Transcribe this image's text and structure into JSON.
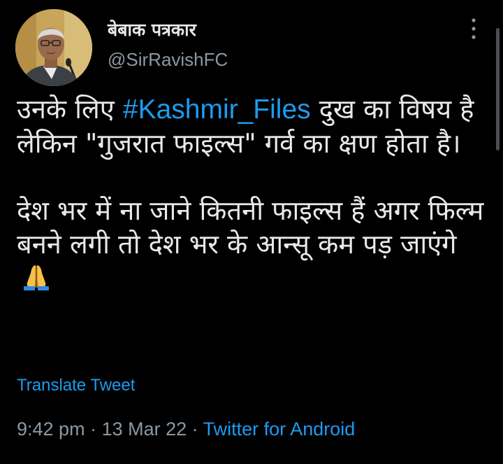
{
  "tweet": {
    "author": {
      "display_name": "बेबाक पत्रकार",
      "handle": "@SirRavishFC",
      "avatar_icon": "profile-photo"
    },
    "more_icon": "more-vertical-icon",
    "text": {
      "line1_before": "उनके लिए ",
      "hashtag": "#Kashmir_Files",
      "line1_after": " दुख का विषय है लेकिन \"गुजरात फाइल्स\" गर्व का क्षण होता है।",
      "para2": "देश भर में ना जाने कितनी फाइल्स हैं अगर फिल्म बनने लगी तो देश भर के आन्सू कम पड़ जाएंगे",
      "emoji": "folded-hands-emoji"
    },
    "translate_label": "Translate Tweet",
    "time": "9:42 pm",
    "separator": " · ",
    "date": "13 Mar 22",
    "source": "Twitter for Android"
  },
  "colors": {
    "background": "#000000",
    "text": "#e7e9ea",
    "secondary": "#8b98a5",
    "accent": "#1d9bf0"
  }
}
